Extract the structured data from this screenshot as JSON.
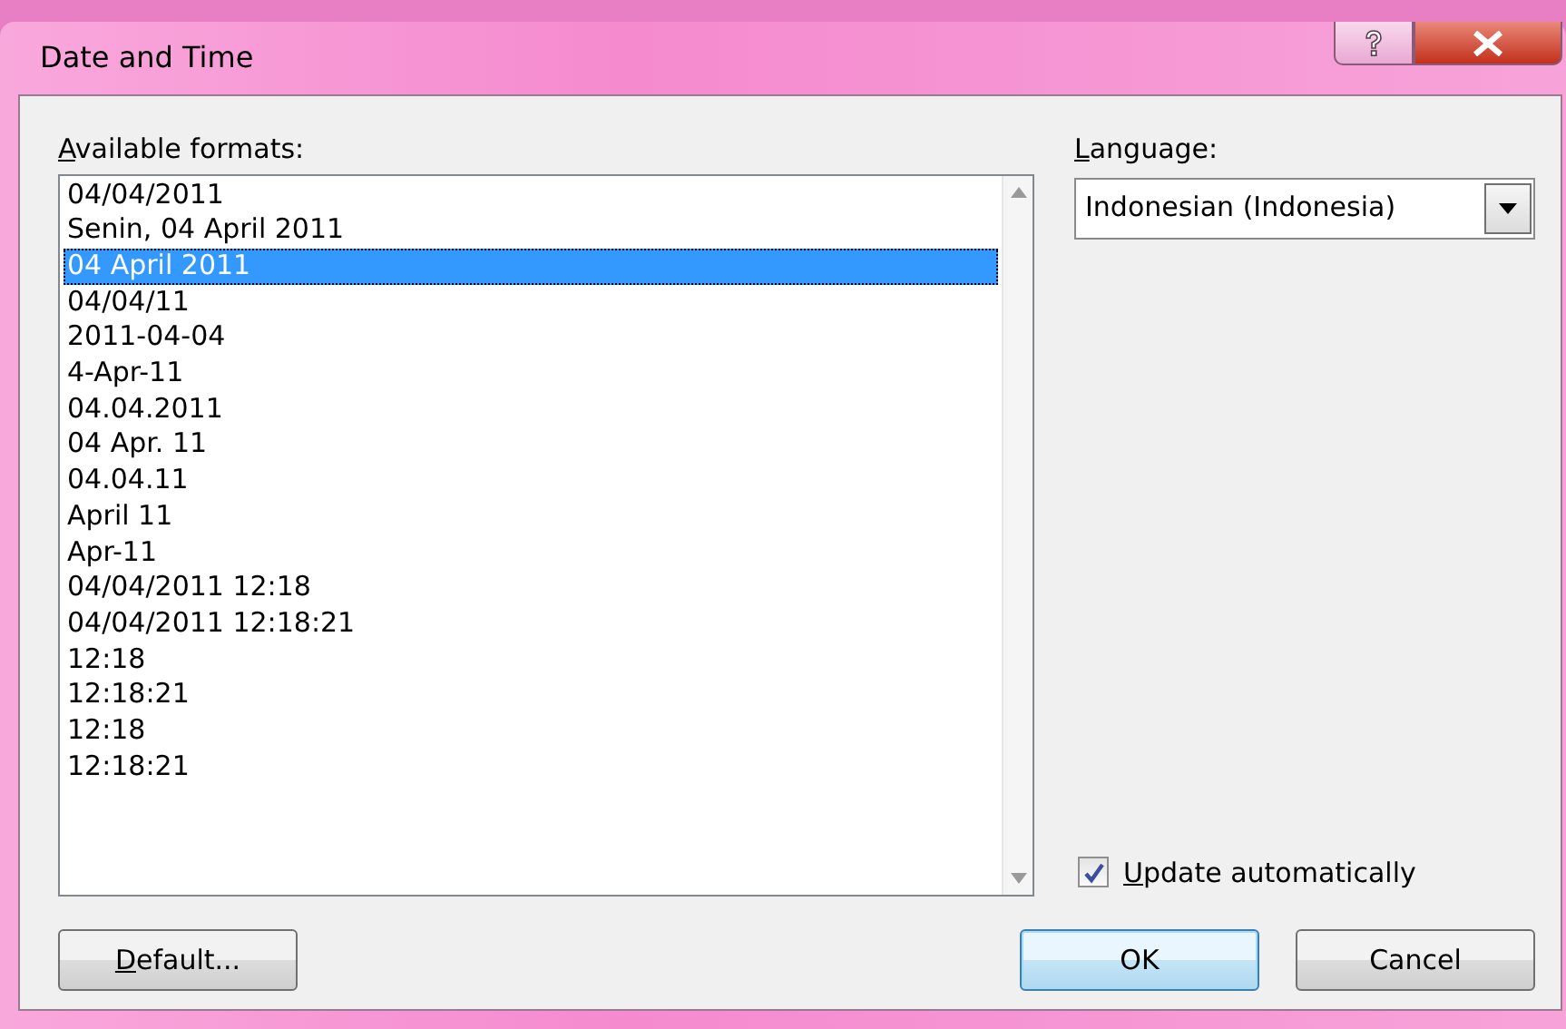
{
  "window": {
    "title": "Date and Time"
  },
  "formats": {
    "label": "Available formats:",
    "first_letter_underlined": true,
    "items": [
      {
        "text": "04/04/2011",
        "selected": false
      },
      {
        "text": "Senin, 04 April 2011",
        "selected": false
      },
      {
        "text": "04 April 2011",
        "selected": true
      },
      {
        "text": "04/04/11",
        "selected": false
      },
      {
        "text": "2011-04-04",
        "selected": false
      },
      {
        "text": "4-Apr-11",
        "selected": false
      },
      {
        "text": "04.04.2011",
        "selected": false
      },
      {
        "text": "04 Apr. 11",
        "selected": false
      },
      {
        "text": "04.04.11",
        "selected": false
      },
      {
        "text": "April 11",
        "selected": false
      },
      {
        "text": "Apr-11",
        "selected": false
      },
      {
        "text": "04/04/2011 12:18",
        "selected": false
      },
      {
        "text": "04/04/2011 12:18:21",
        "selected": false
      },
      {
        "text": "12:18",
        "selected": false
      },
      {
        "text": "12:18:21",
        "selected": false
      },
      {
        "text": "12:18",
        "selected": false
      },
      {
        "text": "12:18:21",
        "selected": false
      }
    ]
  },
  "language": {
    "label": "Language:",
    "first_letter_underlined": true,
    "value": "Indonesian (Indonesia)"
  },
  "update_automatically": {
    "label": "Update automatically",
    "first_letter_underlined": true,
    "checked": true
  },
  "buttons": [
    {
      "label": "Default...",
      "first_letter_underlined": true,
      "default": false
    },
    {
      "label": "OK",
      "default": true
    },
    {
      "label": "Cancel",
      "default": false
    }
  ]
}
